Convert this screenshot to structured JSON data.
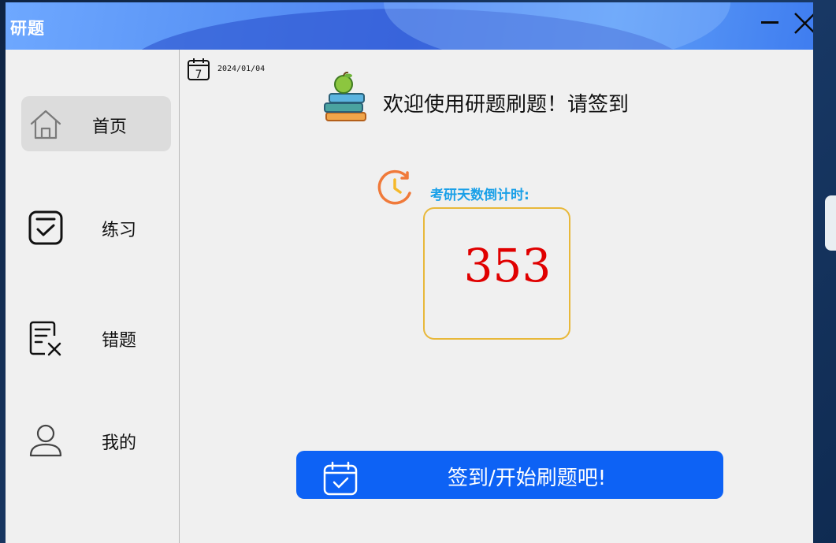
{
  "window": {
    "title": "研题"
  },
  "titlebar": {
    "minimize_icon": "minimize-icon",
    "close_icon": "close-icon"
  },
  "sidebar": {
    "items": [
      {
        "label": "首页",
        "icon": "home-icon",
        "active": true
      },
      {
        "label": "练习",
        "icon": "checkbox-icon",
        "active": false
      },
      {
        "label": "错题",
        "icon": "wrong-document-icon",
        "active": false
      },
      {
        "label": "我的",
        "icon": "user-icon",
        "active": false
      }
    ]
  },
  "main": {
    "date": "2024/01/04",
    "calendar_day": "7",
    "welcome": "欢迎使用研题刷题！请签到",
    "countdown_label": "考研天数倒计时:",
    "countdown_days": "353",
    "signin_button": "签到/开始刷题吧!"
  },
  "colors": {
    "accent_button": "#0d62f5",
    "countdown_number": "#e00000",
    "countdown_label": "#1aa0e8",
    "countdown_border": "#e8b83a",
    "titlebar": "#5b95f6"
  }
}
